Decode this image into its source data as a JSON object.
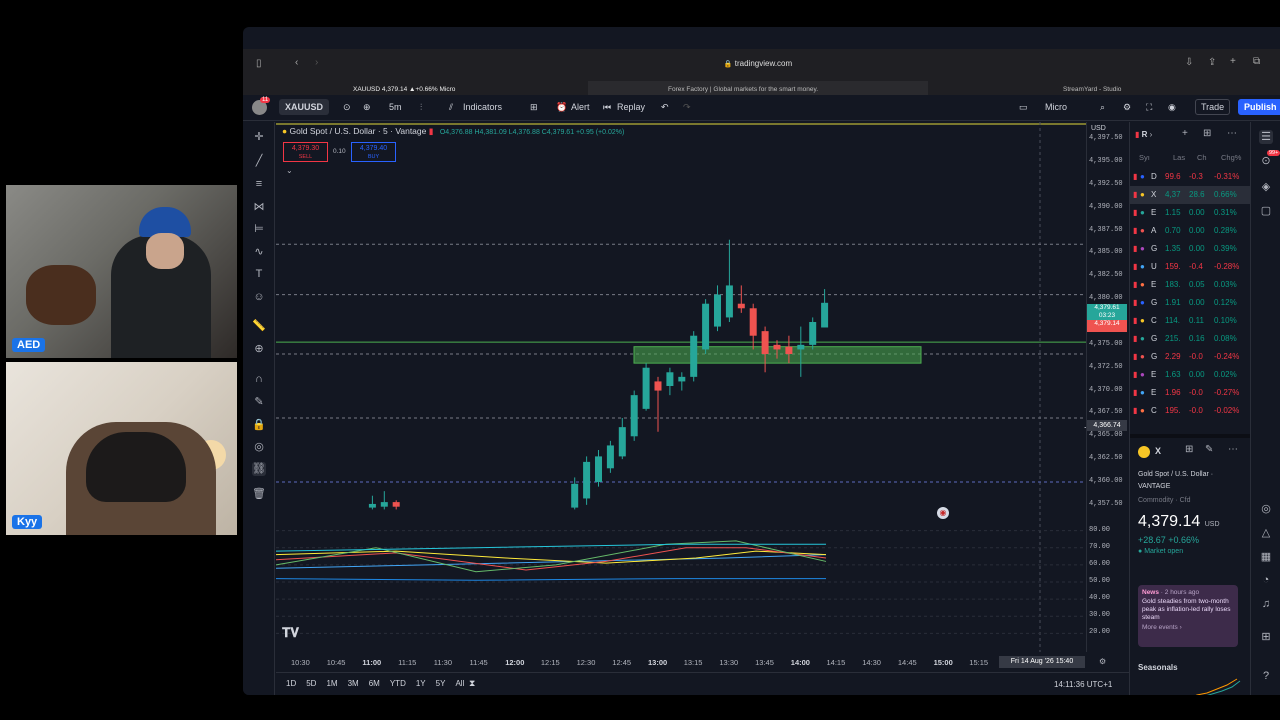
{
  "browser": {
    "url": "tradingview.com",
    "tabs": [
      "XAUUSD 4,379.14 ▲+0.66% Micro",
      "Forex Factory | Global markets for the smart money.",
      "StreamYard - Studio"
    ]
  },
  "toolbar": {
    "symbol": "XAUUSD",
    "interval": "5m",
    "indicators": "Indicators",
    "alert": "Alert",
    "replay": "Replay",
    "micro": "Micro",
    "trade": "Trade",
    "publish": "Publish",
    "notif_count": "11"
  },
  "legend": {
    "title": "Gold Spot / U.S. Dollar · 5 · Vantage",
    "ohlc": "O4,376.88 H4,381.09 L4,376.88 C4,379.61 +0.95 (+0.02%)",
    "sell_price": "4,379.30",
    "sell_label": "SELL",
    "spread": "0.10",
    "buy_price": "4,379.40",
    "buy_label": "BUY",
    "currency": "USD"
  },
  "price_axis": {
    "labels": [
      "4,397.50",
      "4,395.00",
      "4,392.50",
      "4,390.00",
      "4,387.50",
      "4,385.00",
      "4,382.50",
      "4,380.00",
      "4,377.50",
      "4,375.00",
      "4,372.50",
      "4,370.00",
      "4,367.50",
      "4,365.00",
      "4,362.50",
      "4,360.00",
      "4,357.50"
    ],
    "current_price": "4,379.61",
    "countdown": "03:23",
    "bid_price": "4,379.14",
    "crosshair_price": "4,366.74"
  },
  "indicator_axis": [
    "80.00",
    "70.00",
    "60.00",
    "50.00",
    "40.00",
    "30.00",
    "20.00"
  ],
  "time_axis": {
    "ticks": [
      "10:30",
      "10:45",
      "11:00",
      "11:15",
      "11:30",
      "11:45",
      "12:00",
      "12:15",
      "12:30",
      "12:45",
      "13:00",
      "13:15",
      "13:30",
      "13:45",
      "14:00",
      "14:15",
      "14:30",
      "14:45",
      "15:00",
      "15:15"
    ],
    "crosshair_time": "Fri 14 Aug '26   15:40"
  },
  "bottombar": {
    "ranges": [
      "1D",
      "5D",
      "1M",
      "3M",
      "6M",
      "YTD",
      "1Y",
      "5Y",
      "All"
    ],
    "clock": "14:11:36 UTC+1"
  },
  "watchlist": {
    "header": "R",
    "columns": [
      "Syı",
      "Las",
      "Ch",
      "Chg%"
    ],
    "rows": [
      {
        "sym": "D",
        "last": "99.6",
        "chg": "-0.3",
        "pct": "-0.31%",
        "color": "#f23645"
      },
      {
        "sym": "X",
        "last": "4,37",
        "chg": "28.6",
        "pct": "0.66%",
        "color": "#089981"
      },
      {
        "sym": "E",
        "last": "1.15",
        "chg": "0.00",
        "pct": "0.31%",
        "color": "#089981"
      },
      {
        "sym": "A",
        "last": "0.70",
        "chg": "0.00",
        "pct": "0.28%",
        "color": "#089981"
      },
      {
        "sym": "G",
        "last": "1.35",
        "chg": "0.00",
        "pct": "0.39%",
        "color": "#089981"
      },
      {
        "sym": "U",
        "last": "159.",
        "chg": "-0.4",
        "pct": "-0.28%",
        "color": "#f23645"
      },
      {
        "sym": "E",
        "last": "183.",
        "chg": "0.05",
        "pct": "0.03%",
        "color": "#089981"
      },
      {
        "sym": "G",
        "last": "1.91",
        "chg": "0.00",
        "pct": "0.12%",
        "color": "#089981"
      },
      {
        "sym": "C",
        "last": "114.",
        "chg": "0.11",
        "pct": "0.10%",
        "color": "#089981"
      },
      {
        "sym": "G",
        "last": "215.",
        "chg": "0.16",
        "pct": "0.08%",
        "color": "#089981"
      },
      {
        "sym": "G",
        "last": "2.29",
        "chg": "-0.0",
        "pct": "-0.24%",
        "color": "#f23645"
      },
      {
        "sym": "E",
        "last": "1.63",
        "chg": "0.00",
        "pct": "0.02%",
        "color": "#089981"
      },
      {
        "sym": "E",
        "last": "1.96",
        "chg": "-0.0",
        "pct": "-0.27%",
        "color": "#f23645"
      },
      {
        "sym": "C",
        "last": "195.",
        "chg": "-0.0",
        "pct": "-0.02%",
        "color": "#f23645"
      }
    ],
    "detail": {
      "symbol": "X",
      "name": "Gold Spot / U.S. Dollar",
      "exchange": "VANTAGE",
      "type": "Commodity · Cfd",
      "price": "4,379.14",
      "currency": "USD",
      "change": "+28.67 +0.66%",
      "status": "Market open",
      "news_label": "News",
      "news_time": "· 2 hours ago",
      "news_text": "Gold steadies from two-month peak as inflation-led rally loses steam",
      "more": "More events ›",
      "seasonals": "Seasonals"
    }
  },
  "cams": {
    "top_label": "AED",
    "bottom_label": "Kyy"
  },
  "chart_data": {
    "type": "candlestick",
    "ylim": [
      4356.5,
      4398.5
    ],
    "candles": [
      {
        "t": "11:00",
        "o": 4357.2,
        "c": 4357.6,
        "h": 4358.5,
        "l": 4357.0
      },
      {
        "t": "11:05",
        "o": 4357.3,
        "c": 4357.8,
        "h": 4359.0,
        "l": 4357.0
      },
      {
        "t": "11:10",
        "o": 4357.8,
        "c": 4357.3,
        "h": 4358.0,
        "l": 4357.0
      },
      {
        "t": "12:25",
        "o": 4357.2,
        "c": 4359.8,
        "h": 4360.5,
        "l": 4357.0
      },
      {
        "t": "12:30",
        "o": 4358.2,
        "c": 4362.2,
        "h": 4362.8,
        "l": 4357.5
      },
      {
        "t": "12:35",
        "o": 4360.0,
        "c": 4362.8,
        "h": 4363.5,
        "l": 4359.5
      },
      {
        "t": "12:40",
        "o": 4361.5,
        "c": 4364.0,
        "h": 4364.5,
        "l": 4361.0
      },
      {
        "t": "12:45",
        "o": 4362.8,
        "c": 4366.0,
        "h": 4367.0,
        "l": 4362.5
      },
      {
        "t": "12:50",
        "o": 4365.0,
        "c": 4369.5,
        "h": 4370.0,
        "l": 4364.5
      },
      {
        "t": "12:55",
        "o": 4368.0,
        "c": 4372.5,
        "h": 4373.0,
        "l": 4367.8
      },
      {
        "t": "13:00",
        "o": 4371.0,
        "c": 4370.0,
        "h": 4371.5,
        "l": 4365.5
      },
      {
        "t": "13:05",
        "o": 4370.5,
        "c": 4372.0,
        "h": 4372.5,
        "l": 4369.5
      },
      {
        "t": "13:10",
        "o": 4371.0,
        "c": 4371.5,
        "h": 4372.0,
        "l": 4370.0
      },
      {
        "t": "13:15",
        "o": 4371.5,
        "c": 4376.0,
        "h": 4376.5,
        "l": 4371.0
      },
      {
        "t": "13:20",
        "o": 4374.5,
        "c": 4379.5,
        "h": 4380.0,
        "l": 4374.0
      },
      {
        "t": "13:25",
        "o": 4377.0,
        "c": 4380.5,
        "h": 4381.5,
        "l": 4376.5
      },
      {
        "t": "13:30",
        "o": 4378.0,
        "c": 4381.5,
        "h": 4386.5,
        "l": 4377.5
      },
      {
        "t": "13:35",
        "o": 4379.5,
        "c": 4379.0,
        "h": 4381.5,
        "l": 4378.5
      },
      {
        "t": "13:40",
        "o": 4379.0,
        "c": 4376.0,
        "h": 4379.5,
        "l": 4374.5
      },
      {
        "t": "13:45",
        "o": 4376.5,
        "c": 4374.0,
        "h": 4377.0,
        "l": 4372.0
      },
      {
        "t": "13:50",
        "o": 4375.0,
        "c": 4374.5,
        "h": 4375.5,
        "l": 4373.5
      },
      {
        "t": "13:55",
        "o": 4374.8,
        "c": 4374.0,
        "h": 4376.0,
        "l": 4373.0
      },
      {
        "t": "14:00",
        "o": 4374.5,
        "c": 4375.0,
        "h": 4377.0,
        "l": 4371.5
      },
      {
        "t": "14:05",
        "o": 4375.0,
        "c": 4377.5,
        "h": 4378.0,
        "l": 4374.5
      },
      {
        "t": "14:10",
        "o": 4376.9,
        "c": 4379.6,
        "h": 4381.1,
        "l": 4376.9
      }
    ],
    "levels": [
      4386.0,
      4380.5,
      4374.0,
      4367.0,
      4360.0
    ],
    "zone": [
      4373.0,
      4374.8
    ]
  },
  "colors": {
    "up": "#26a69a",
    "down": "#ef5350",
    "accent": "#2962ff",
    "zone": "#4caf50"
  }
}
